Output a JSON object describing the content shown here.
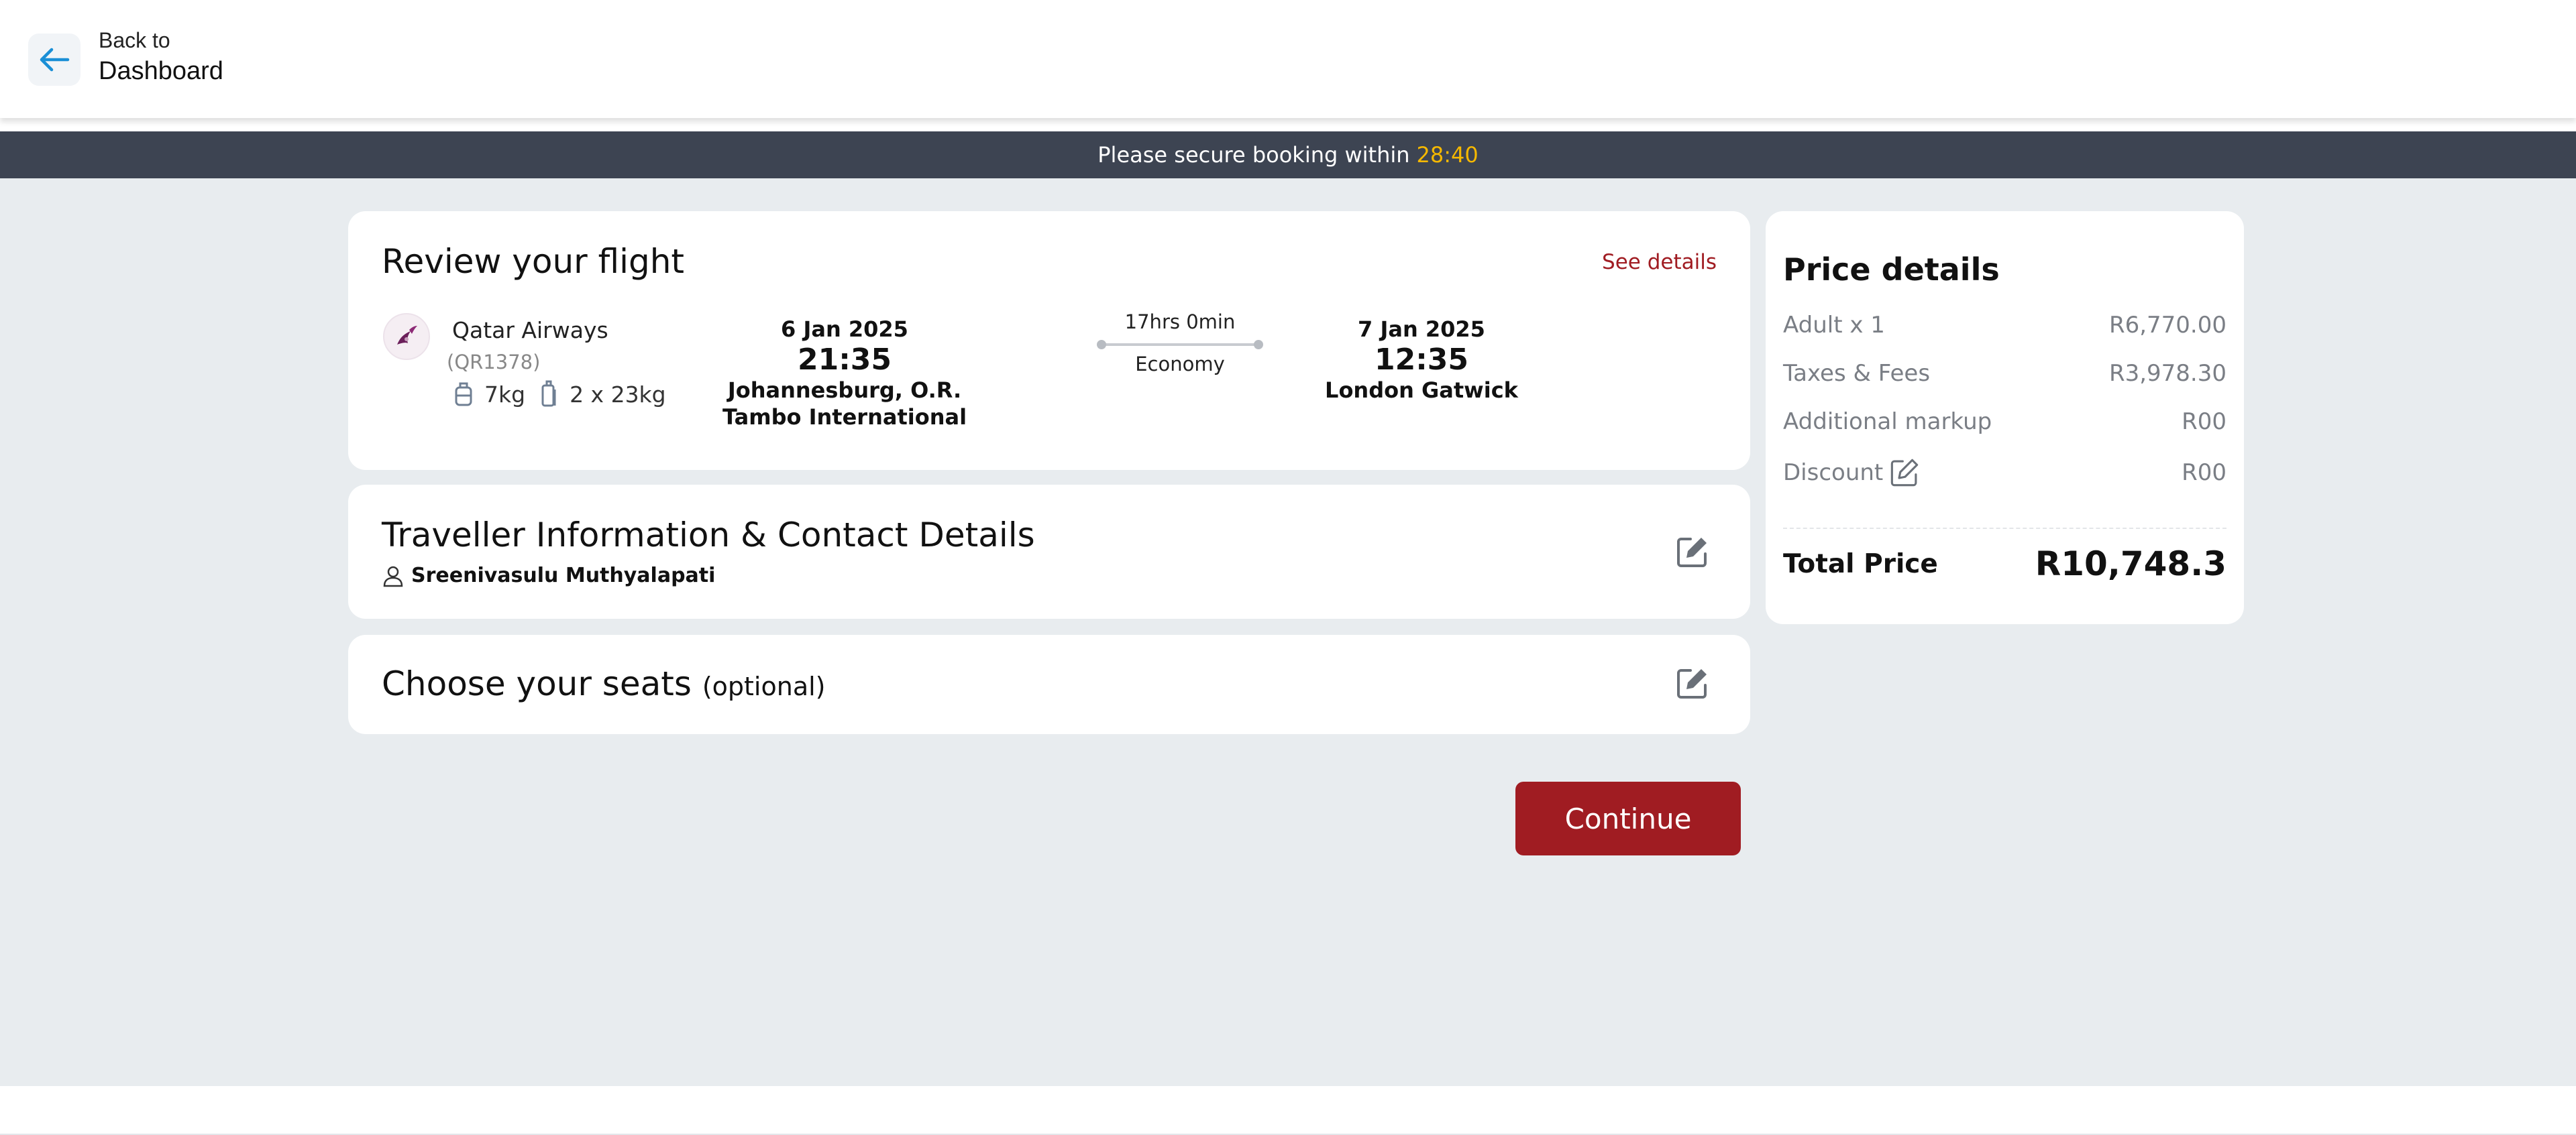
{
  "header": {
    "back_small": "Back to",
    "back_big": "Dashboard",
    "back_icon": "arrow-left-icon"
  },
  "timer": {
    "text": "Please secure booking within",
    "time": "28:40"
  },
  "review": {
    "title": "Review your flight",
    "see_details": "See details",
    "airline": "Qatar Airways",
    "flight_no": "(QR1378)",
    "cabin_bag": "7kg",
    "checked_bag": "2 x 23kg",
    "departure": {
      "date": "6 Jan 2025",
      "time": "21:35",
      "city": "Johannesburg, O.R. Tambo International"
    },
    "duration": "17hrs 0min",
    "cabin": "Economy",
    "arrival": {
      "date": "7 Jan 2025",
      "time": "12:35",
      "city": "London Gatwick"
    }
  },
  "traveller": {
    "title": "Traveller Information & Contact Details",
    "name": "Sreenivasulu Muthyalapati"
  },
  "seats": {
    "title": "Choose your seats",
    "optional": "(optional)"
  },
  "price": {
    "title": "Price details",
    "rows": [
      {
        "label": "Adult x 1",
        "value": "R6,770.00"
      },
      {
        "label": "Taxes & Fees",
        "value": "R3,978.30"
      },
      {
        "label": "Additional markup",
        "value": "R00"
      },
      {
        "label": "Discount",
        "value": "R00"
      }
    ],
    "total_label": "Total Price",
    "total_value": "R10,748.3"
  },
  "actions": {
    "continue": "Continue"
  },
  "colors": {
    "accent": "#a01c22",
    "banner": "#3d4452",
    "timer": "#f5b800",
    "background": "#e8ecef"
  }
}
